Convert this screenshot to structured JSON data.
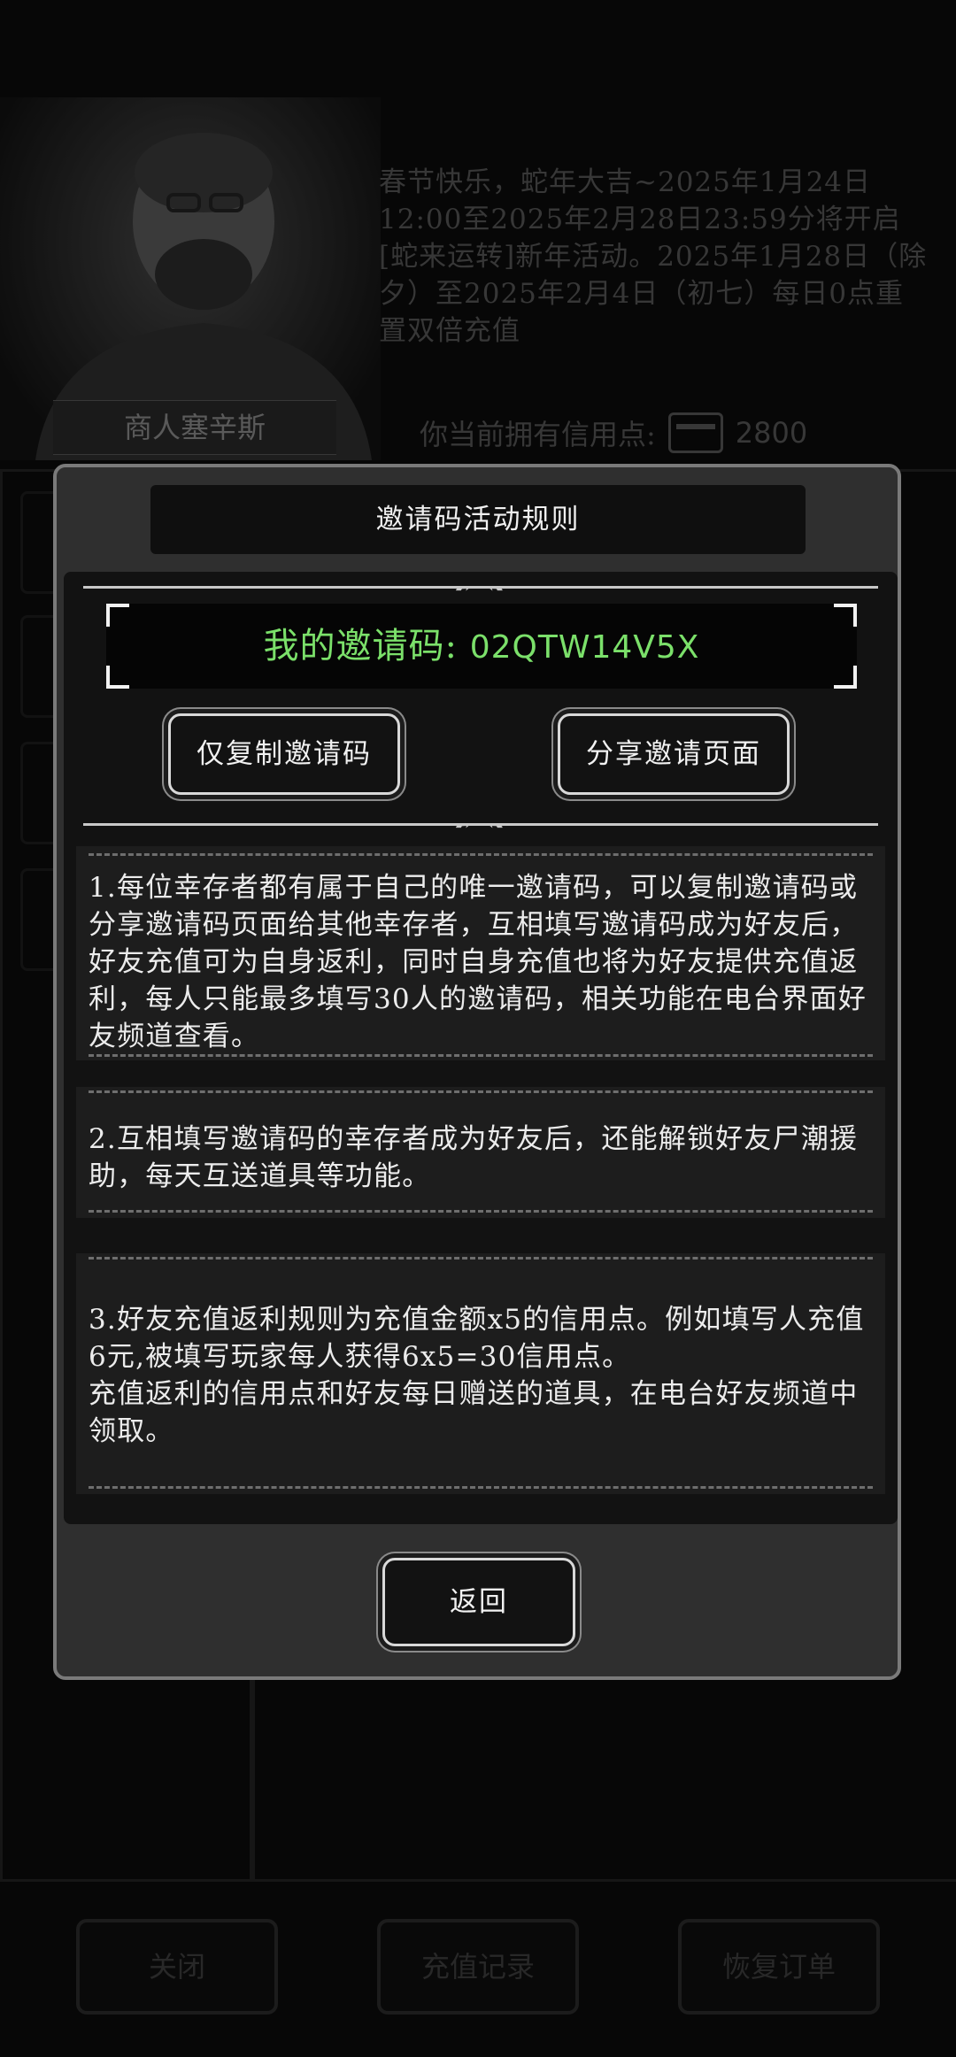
{
  "background": {
    "merchant_name": "商人塞辛斯",
    "announcement": "春节快乐，蛇年大吉~2025年1月24日12:00至2025年2月28日23:59分将开启[蛇来运转]新年活动。2025年1月28日（除夕）至2025年2月4日（初七）每日0点重置双倍充值",
    "credits_label": "你当前拥有信用点:",
    "credits_value": "2800",
    "bottom_buttons": [
      "关闭",
      "充值记录",
      "恢复订单"
    ]
  },
  "dialog": {
    "title": "邀请码活动规则",
    "code_label": "我的邀请码:",
    "code_value": "02QTW14V5X",
    "copy_button": "仅复制邀请码",
    "share_button": "分享邀请页面",
    "rules": [
      "1.每位幸存者都有属于自己的唯一邀请码，可以复制邀请码或分享邀请码页面给其他幸存者，互相填写邀请码成为好友后，好友充值可为自身返利，同时自身充值也将为好友提供充值返利，每人只能最多填写30人的邀请码，相关功能在电台界面好友频道查看。",
      "2.互相填写邀请码的幸存者成为好友后，还能解锁好友尸潮援助，每天互送道具等功能。",
      "3.好友充值返利规则为充值金额x5的信用点。例如填写人充值6元,被填写玩家每人获得6x5=30信用点。\n充值返利的信用点和好友每日赠送的道具，在电台好友频道中领取。"
    ],
    "back_button": "返回"
  },
  "icons": {
    "divider_arrows": "arrow-pair-icon",
    "credit": "credit-card-icon"
  }
}
